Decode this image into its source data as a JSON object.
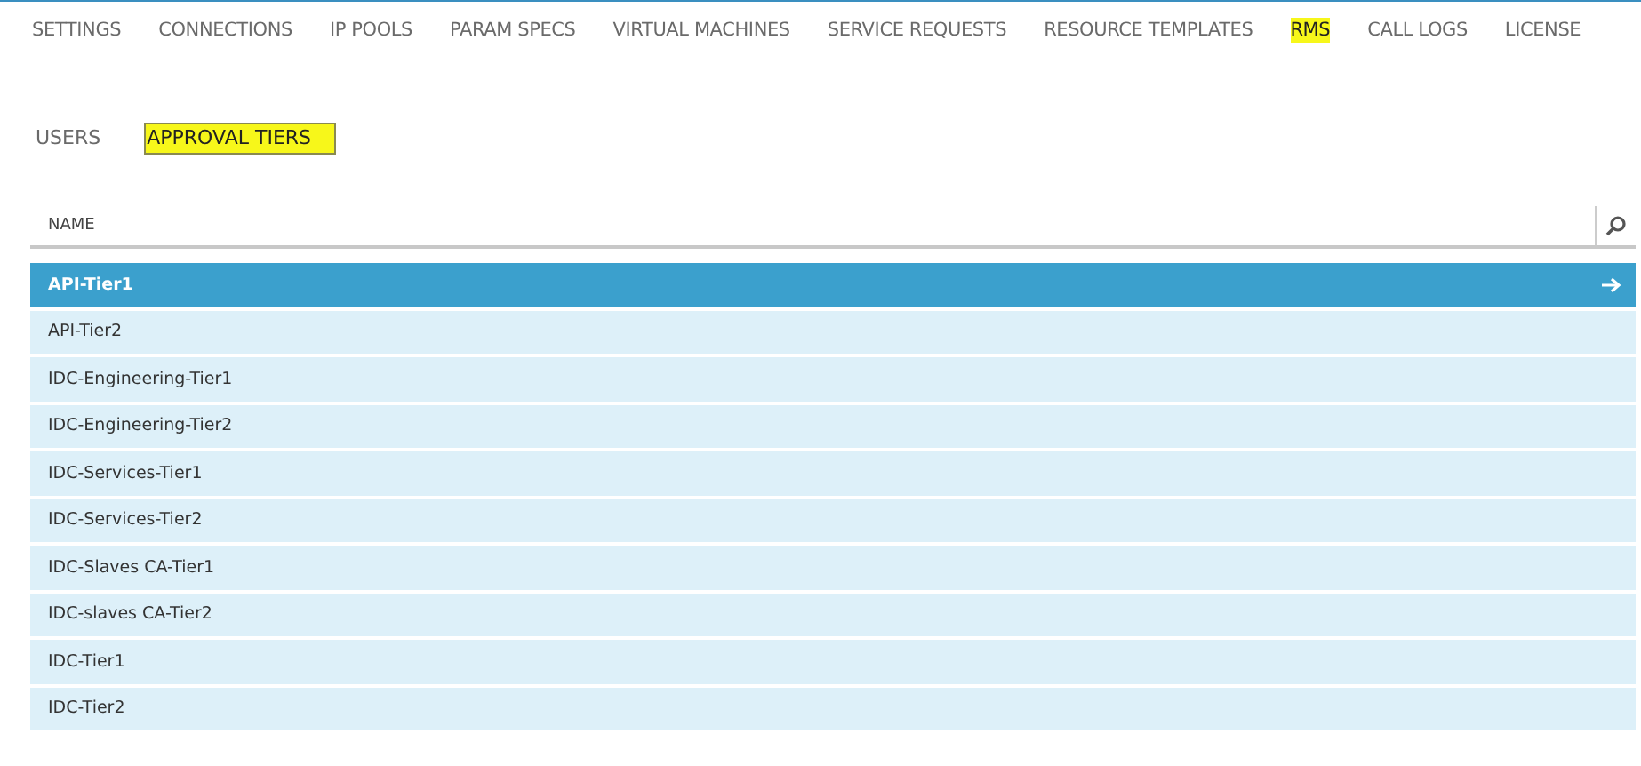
{
  "nav": [
    {
      "label": "SETTINGS",
      "highlighted": false
    },
    {
      "label": "CONNECTIONS",
      "highlighted": false
    },
    {
      "label": "IP POOLS",
      "highlighted": false
    },
    {
      "label": "PARAM SPECS",
      "highlighted": false
    },
    {
      "label": "VIRTUAL MACHINES",
      "highlighted": false
    },
    {
      "label": "SERVICE REQUESTS",
      "highlighted": false
    },
    {
      "label": "RESOURCE TEMPLATES",
      "highlighted": false
    },
    {
      "label": "RMS",
      "highlighted": true
    },
    {
      "label": "CALL LOGS",
      "highlighted": false
    },
    {
      "label": "LICENSE",
      "highlighted": false
    }
  ],
  "subtabs": [
    {
      "label": "USERS",
      "highlighted": false
    },
    {
      "label": "APPROVAL TIERS",
      "highlighted": true
    }
  ],
  "table": {
    "columns": [
      "NAME"
    ],
    "rows": [
      {
        "name": "API-Tier1",
        "selected": true
      },
      {
        "name": "API-Tier2",
        "selected": false
      },
      {
        "name": "IDC-Engineering-Tier1",
        "selected": false
      },
      {
        "name": "IDC-Engineering-Tier2",
        "selected": false
      },
      {
        "name": "IDC-Services-Tier1",
        "selected": false
      },
      {
        "name": "IDC-Services-Tier2",
        "selected": false
      },
      {
        "name": "IDC-Slaves CA-Tier1",
        "selected": false
      },
      {
        "name": "IDC-slaves CA-Tier2",
        "selected": false
      },
      {
        "name": "IDC-Tier1",
        "selected": false
      },
      {
        "name": "IDC-Tier2",
        "selected": false
      }
    ]
  }
}
